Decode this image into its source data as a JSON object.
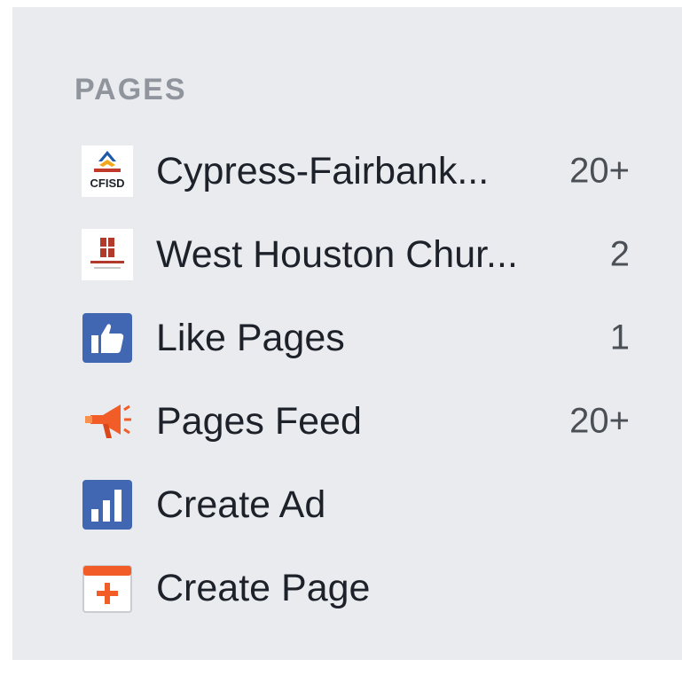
{
  "section": {
    "title": "PAGES"
  },
  "pages": [
    {
      "icon": "cypress-fairbanks-logo-icon",
      "label": "Cypress-Fairbank...",
      "count": "20+"
    },
    {
      "icon": "west-houston-church-logo-icon",
      "label": "West Houston Chur...",
      "count": "2"
    },
    {
      "icon": "thumbs-up-icon",
      "label": "Like Pages",
      "count": "1"
    },
    {
      "icon": "megaphone-icon",
      "label": "Pages Feed",
      "count": "20+"
    },
    {
      "icon": "bar-chart-icon",
      "label": "Create Ad",
      "count": ""
    },
    {
      "icon": "calendar-plus-icon",
      "label": "Create Page",
      "count": ""
    }
  ],
  "logo_text": {
    "cypress": "CFISD"
  },
  "colors": {
    "panel_bg": "#e9ebee",
    "title": "#90949c",
    "label": "#1d2129",
    "count": "#4b4f56",
    "fb_blue": "#3b5998",
    "icon_blue": "#4267b2",
    "orange": "#f25c27",
    "brick": "#b23a2a"
  }
}
